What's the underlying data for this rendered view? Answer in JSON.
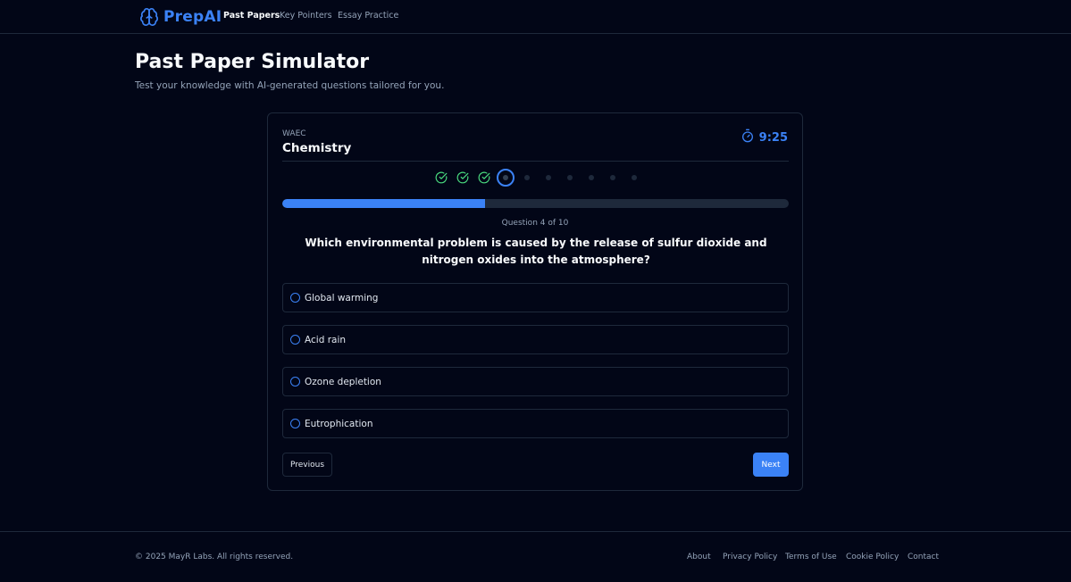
{
  "brand": {
    "name": "PrepAI",
    "color": "#3b82f6"
  },
  "nav": {
    "links": [
      {
        "label": "Past Papers",
        "active": true
      },
      {
        "label": "Key Pointers",
        "active": false
      },
      {
        "label": "Essay Practice",
        "active": false
      }
    ]
  },
  "page": {
    "title": "Past Paper Simulator",
    "subtitle": "Test your knowledge with AI-generated questions tailored for you."
  },
  "quiz": {
    "exam_board": "WAEC",
    "subject": "Chemistry",
    "timer": "9:25",
    "steps": [
      "completed",
      "completed",
      "completed",
      "current",
      "pending",
      "pending",
      "pending",
      "pending",
      "pending",
      "pending"
    ],
    "progress_fraction": 0.4,
    "counter": "Question 4 of 10",
    "question": "Which environmental problem is caused by the release of sulfur dioxide and nitrogen oxides into the atmosphere?",
    "options": [
      "Global warming",
      "Acid rain",
      "Ozone depletion",
      "Eutrophication"
    ],
    "previous_label": "Previous",
    "next_label": "Next"
  },
  "footer": {
    "copyright": "© 2025 MayR Labs. All rights reserved.",
    "links": [
      "About",
      "Privacy Policy",
      "Terms of Use",
      "Cookie Policy",
      "Contact"
    ]
  },
  "colors": {
    "accent": "#3b82f6",
    "success": "#4ade80",
    "background": "#020617",
    "border": "#1e293b"
  }
}
